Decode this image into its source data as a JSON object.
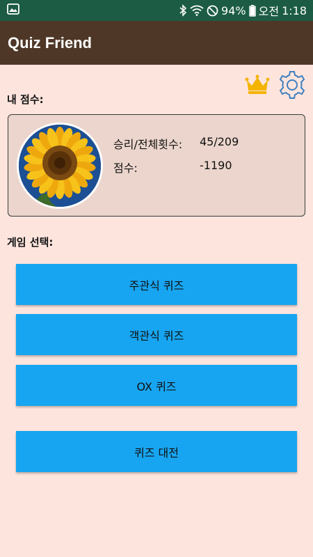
{
  "status_bar": {
    "battery_percent": "94%",
    "ampm": "오전",
    "time": "1:18",
    "icons": [
      "gallery-icon",
      "bluetooth-icon",
      "wifi-icon",
      "do-not-disturb-icon",
      "battery-icon"
    ]
  },
  "app_bar": {
    "title": "Quiz Friend"
  },
  "toolbar_icons": [
    "crown-icon",
    "gear-icon"
  ],
  "my_score": {
    "section_label": "내 점수:",
    "wins_label": "승리/전체횟수:",
    "wins_value": "45/209",
    "score_label": "점수:",
    "score_value": "-1190"
  },
  "game_select": {
    "section_label": "게임 선택:",
    "buttons": [
      "주관식 퀴즈",
      "객관식 퀴즈",
      "OX 퀴즈",
      "퀴즈 대전"
    ]
  },
  "colors": {
    "status_bar": "#1c5c45",
    "app_bar": "#4e3727",
    "background": "#fde5de",
    "card": "#ebd5cc",
    "button": "#17a5f1",
    "crown": "#f4b400",
    "gear": "#3f7fbf"
  }
}
